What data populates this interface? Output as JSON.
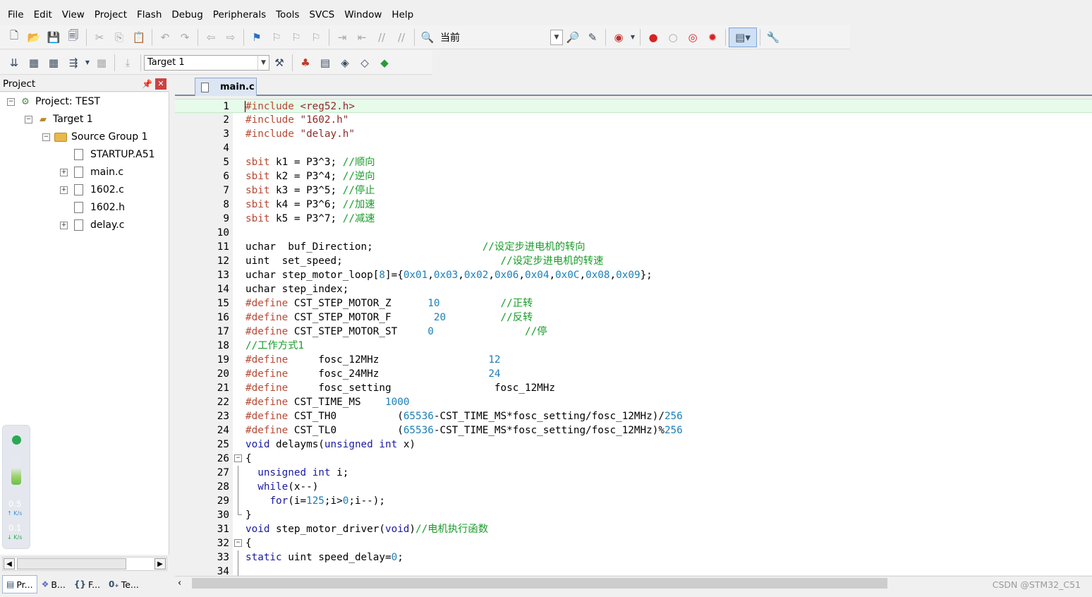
{
  "menu": [
    "File",
    "Edit",
    "View",
    "Project",
    "Flash",
    "Debug",
    "Peripherals",
    "Tools",
    "SVCS",
    "Window",
    "Help"
  ],
  "toolbar1": {
    "find_text": "当前"
  },
  "toolbar2": {
    "target": "Target 1"
  },
  "project_panel": {
    "title": "Project"
  },
  "tree": [
    {
      "label": "Project: TEST",
      "expander": "−",
      "icon": "project-icon"
    },
    {
      "label": "Target 1",
      "expander": "−",
      "icon": "target-icon"
    },
    {
      "label": "Source Group 1",
      "expander": "−",
      "icon": "folder-icon"
    },
    {
      "label": "STARTUP.A51",
      "expander": "",
      "icon": "file-icon"
    },
    {
      "label": "main.c",
      "expander": "+",
      "icon": "file-icon"
    },
    {
      "label": "1602.c",
      "expander": "+",
      "icon": "file-icon"
    },
    {
      "label": "1602.h",
      "expander": "",
      "icon": "file-icon"
    },
    {
      "label": "delay.c",
      "expander": "+",
      "icon": "file-icon"
    }
  ],
  "net_widget": {
    "up_value": "0.5",
    "up_unit": "K/s",
    "down_value": "0.1",
    "down_unit": "K/s"
  },
  "panel_tabs": [
    "Pr...",
    "B...",
    "F...",
    "Te..."
  ],
  "editor": {
    "active_tab": "main.c"
  },
  "code_colors": {
    "default": "#000000",
    "keyword": "#1a1aa6",
    "macro": "#b84a35",
    "string": "#8f2a2a",
    "number": "#1c7fb8",
    "comment": "#1a9c2a"
  },
  "code": [
    {
      "n": "1",
      "t": [
        [
          "#include <reg52.h>",
          "m"
        ]
      ]
    },
    {
      "n": "2",
      "t": [
        [
          "#include \"1602.h\"",
          "m"
        ]
      ]
    },
    {
      "n": "3",
      "t": [
        [
          "#include \"delay.h\"",
          "m"
        ]
      ]
    },
    {
      "n": "4",
      "t": []
    },
    {
      "n": "5",
      "t": [
        [
          "sbit",
          "m"
        ],
        [
          " k1 = P3^3; ",
          ""
        ],
        [
          "//顺向",
          "c"
        ]
      ]
    },
    {
      "n": "6",
      "t": [
        [
          "sbit",
          "m"
        ],
        [
          " k2 = P3^4; ",
          ""
        ],
        [
          "//逆向",
          "c"
        ]
      ]
    },
    {
      "n": "7",
      "t": [
        [
          "sbit",
          "m"
        ],
        [
          " k3 = P3^5; ",
          ""
        ],
        [
          "//停止",
          "c"
        ]
      ]
    },
    {
      "n": "8",
      "t": [
        [
          "sbit",
          "m"
        ],
        [
          " k4 = P3^6; ",
          ""
        ],
        [
          "//加速",
          "c"
        ]
      ]
    },
    {
      "n": "9",
      "t": [
        [
          "sbit",
          "m"
        ],
        [
          " k5 = P3^7; ",
          ""
        ],
        [
          "//减速",
          "c"
        ]
      ]
    },
    {
      "n": "10",
      "t": []
    },
    {
      "n": "11",
      "t": [
        [
          "uchar  buf_Direction;                  ",
          ""
        ],
        [
          "//设定步进电机的转向",
          "c"
        ]
      ]
    },
    {
      "n": "12",
      "t": [
        [
          "uint  set_speed;                          ",
          ""
        ],
        [
          "//设定步进电机的转速",
          "c"
        ]
      ]
    },
    {
      "n": "13",
      "t": [
        [
          "uchar step_motor_loop[",
          ""
        ],
        [
          "8",
          "n"
        ],
        [
          "]={",
          ""
        ],
        [
          "0x01",
          "n"
        ],
        [
          ",",
          ""
        ],
        [
          "0x03",
          "n"
        ],
        [
          ",",
          ""
        ],
        [
          "0x02",
          "n"
        ],
        [
          ",",
          ""
        ],
        [
          "0x06",
          "n"
        ],
        [
          ",",
          ""
        ],
        [
          "0x04",
          "n"
        ],
        [
          ",",
          ""
        ],
        [
          "0x0C",
          "n"
        ],
        [
          ",",
          ""
        ],
        [
          "0x08",
          "n"
        ],
        [
          ",",
          ""
        ],
        [
          "0x09",
          "n"
        ],
        [
          "};",
          ""
        ]
      ]
    },
    {
      "n": "14",
      "t": [
        [
          "uchar step_index;",
          ""
        ]
      ]
    },
    {
      "n": "15",
      "t": [
        [
          "#define",
          "m"
        ],
        [
          " CST_STEP_MOTOR_Z      ",
          ""
        ],
        [
          "10",
          "n"
        ],
        [
          "          ",
          ""
        ],
        [
          "//正转",
          "c"
        ]
      ]
    },
    {
      "n": "16",
      "t": [
        [
          "#define",
          "m"
        ],
        [
          " CST_STEP_MOTOR_F       ",
          ""
        ],
        [
          "20",
          "n"
        ],
        [
          "         ",
          ""
        ],
        [
          "//反转",
          "c"
        ]
      ]
    },
    {
      "n": "17",
      "t": [
        [
          "#define",
          "m"
        ],
        [
          " CST_STEP_MOTOR_ST     ",
          ""
        ],
        [
          "0",
          "n"
        ],
        [
          "               ",
          ""
        ],
        [
          "//停",
          "c"
        ]
      ]
    },
    {
      "n": "18",
      "t": [
        [
          "//工作方式1",
          "c"
        ]
      ]
    },
    {
      "n": "19",
      "t": [
        [
          "#define",
          "m"
        ],
        [
          "     fosc_12MHz                  ",
          ""
        ],
        [
          "12",
          "n"
        ]
      ]
    },
    {
      "n": "20",
      "t": [
        [
          "#define",
          "m"
        ],
        [
          "     fosc_24MHz                  ",
          ""
        ],
        [
          "24",
          "n"
        ]
      ]
    },
    {
      "n": "21",
      "t": [
        [
          "#define",
          "m"
        ],
        [
          "     fosc_setting                 fosc_12MHz",
          ""
        ]
      ]
    },
    {
      "n": "22",
      "t": [
        [
          "#define",
          "m"
        ],
        [
          " CST_TIME_MS    ",
          ""
        ],
        [
          "1000",
          "n"
        ]
      ]
    },
    {
      "n": "23",
      "t": [
        [
          "#define",
          "m"
        ],
        [
          " CST_TH0          (",
          ""
        ],
        [
          "65536",
          "n"
        ],
        [
          "-CST_TIME_MS*fosc_setting/fosc_12MHz)/",
          ""
        ],
        [
          "256",
          "n"
        ]
      ]
    },
    {
      "n": "24",
      "t": [
        [
          "#define",
          "m"
        ],
        [
          " CST_TL0          (",
          ""
        ],
        [
          "65536",
          "n"
        ],
        [
          "-CST_TIME_MS*fosc_setting/fosc_12MHz)%",
          ""
        ],
        [
          "256",
          "n"
        ]
      ]
    },
    {
      "n": "25",
      "t": [
        [
          "void",
          "k"
        ],
        [
          " delayms(",
          ""
        ],
        [
          "unsigned",
          "k"
        ],
        [
          " ",
          ""
        ],
        [
          "int",
          "k"
        ],
        [
          " x)",
          ""
        ]
      ]
    },
    {
      "n": "26",
      "t": [
        [
          "{",
          ""
        ]
      ]
    },
    {
      "n": "27",
      "t": [
        [
          "  ",
          ""
        ],
        [
          "unsigned",
          "k"
        ],
        [
          " ",
          ""
        ],
        [
          "int",
          "k"
        ],
        [
          " i;",
          ""
        ]
      ]
    },
    {
      "n": "28",
      "t": [
        [
          "  ",
          ""
        ],
        [
          "while",
          "k"
        ],
        [
          "(x--)",
          ""
        ]
      ]
    },
    {
      "n": "29",
      "t": [
        [
          "    ",
          ""
        ],
        [
          "for",
          "k"
        ],
        [
          "(i=",
          ""
        ],
        [
          "125",
          "n"
        ],
        [
          ";i>",
          ""
        ],
        [
          "0",
          "n"
        ],
        [
          ";i--);",
          ""
        ]
      ]
    },
    {
      "n": "30",
      "t": [
        [
          "}",
          ""
        ]
      ]
    },
    {
      "n": "31",
      "t": [
        [
          "void",
          "k"
        ],
        [
          " step_motor_driver(",
          ""
        ],
        [
          "void",
          "k"
        ],
        [
          ")",
          ""
        ],
        [
          "//电机执行函数",
          "c"
        ]
      ]
    },
    {
      "n": "32",
      "t": [
        [
          "{",
          ""
        ]
      ]
    },
    {
      "n": "33",
      "t": [
        [
          "static",
          "k"
        ],
        [
          " uint speed_delay=",
          ""
        ],
        [
          "0",
          "n"
        ],
        [
          ";",
          ""
        ]
      ]
    },
    {
      "n": "34",
      "t": []
    }
  ],
  "watermark": "CSDN @STM32_C51"
}
